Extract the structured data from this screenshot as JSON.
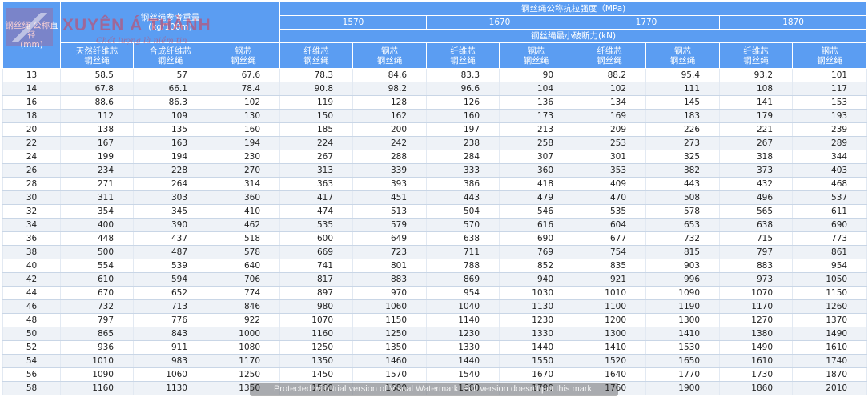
{
  "header": {
    "diameter": "钢丝绳 公称直径",
    "diameter_unit": "(mm)",
    "weight": "钢丝绳参考重量",
    "weight_unit": "(kg/100m)",
    "strength": "钢丝绳公称抗拉强度（MPa)",
    "grades": [
      "1570",
      "1670",
      "1770",
      "1870"
    ],
    "breaking": "钢丝绳最小破断力(kN)",
    "weight_cols": [
      [
        "天然纤维芯",
        "钢丝绳"
      ],
      [
        "合成纤维芯",
        "钢丝绳"
      ],
      [
        "钢芯",
        "钢丝绳"
      ]
    ],
    "core_cols": [
      [
        "纤维芯",
        "钢丝绳"
      ],
      [
        "钢芯",
        "钢丝绳"
      ]
    ]
  },
  "rows": [
    [
      "13",
      "58.5",
      "57",
      "67.6",
      "78.3",
      "84.6",
      "83.3",
      "90",
      "88.2",
      "95.4",
      "93.2",
      "101"
    ],
    [
      "14",
      "67.8",
      "66.1",
      "78.4",
      "90.8",
      "98.2",
      "96.6",
      "104",
      "102",
      "111",
      "108",
      "117"
    ],
    [
      "16",
      "88.6",
      "86.3",
      "102",
      "119",
      "128",
      "126",
      "136",
      "134",
      "145",
      "141",
      "153"
    ],
    [
      "18",
      "112",
      "109",
      "130",
      "150",
      "162",
      "160",
      "173",
      "169",
      "183",
      "179",
      "193"
    ],
    [
      "20",
      "138",
      "135",
      "160",
      "185",
      "200",
      "197",
      "213",
      "209",
      "226",
      "221",
      "239"
    ],
    [
      "22",
      "167",
      "163",
      "194",
      "224",
      "242",
      "238",
      "258",
      "253",
      "273",
      "267",
      "289"
    ],
    [
      "24",
      "199",
      "194",
      "230",
      "267",
      "288",
      "284",
      "307",
      "301",
      "325",
      "318",
      "344"
    ],
    [
      "26",
      "234",
      "228",
      "270",
      "313",
      "339",
      "333",
      "360",
      "353",
      "382",
      "373",
      "403"
    ],
    [
      "28",
      "271",
      "264",
      "314",
      "363",
      "393",
      "386",
      "418",
      "409",
      "443",
      "432",
      "468"
    ],
    [
      "30",
      "311",
      "303",
      "360",
      "417",
      "451",
      "443",
      "479",
      "470",
      "508",
      "496",
      "537"
    ],
    [
      "32",
      "354",
      "345",
      "410",
      "474",
      "513",
      "504",
      "546",
      "535",
      "578",
      "565",
      "611"
    ],
    [
      "34",
      "400",
      "390",
      "462",
      "535",
      "579",
      "570",
      "616",
      "604",
      "653",
      "638",
      "690"
    ],
    [
      "36",
      "448",
      "437",
      "518",
      "600",
      "649",
      "638",
      "690",
      "677",
      "732",
      "715",
      "773"
    ],
    [
      "38",
      "500",
      "487",
      "578",
      "669",
      "723",
      "711",
      "769",
      "754",
      "815",
      "797",
      "861"
    ],
    [
      "40",
      "554",
      "539",
      "640",
      "741",
      "801",
      "788",
      "852",
      "835",
      "903",
      "883",
      "954"
    ],
    [
      "42",
      "610",
      "594",
      "706",
      "817",
      "883",
      "869",
      "940",
      "921",
      "996",
      "973",
      "1050"
    ],
    [
      "44",
      "670",
      "652",
      "774",
      "897",
      "970",
      "954",
      "1030",
      "1010",
      "1090",
      "1070",
      "1150"
    ],
    [
      "46",
      "732",
      "713",
      "846",
      "980",
      "1060",
      "1040",
      "1130",
      "1100",
      "1190",
      "1170",
      "1260"
    ],
    [
      "48",
      "797",
      "776",
      "922",
      "1070",
      "1150",
      "1140",
      "1230",
      "1200",
      "1300",
      "1270",
      "1370"
    ],
    [
      "50",
      "865",
      "843",
      "1000",
      "1160",
      "1250",
      "1230",
      "1330",
      "1300",
      "1410",
      "1380",
      "1490"
    ],
    [
      "52",
      "936",
      "911",
      "1080",
      "1250",
      "1350",
      "1330",
      "1440",
      "1410",
      "1530",
      "1490",
      "1610"
    ],
    [
      "54",
      "1010",
      "983",
      "1170",
      "1350",
      "1460",
      "1440",
      "1550",
      "1520",
      "1650",
      "1610",
      "1740"
    ],
    [
      "56",
      "1090",
      "1060",
      "1250",
      "1450",
      "1570",
      "1540",
      "1670",
      "1640",
      "1770",
      "1730",
      "1870"
    ],
    [
      "58",
      "1160",
      "1130",
      "1350",
      "1560",
      "1680",
      "1660",
      "1790",
      "1760",
      "1900",
      "1860",
      "2010"
    ]
  ],
  "watermarks": {
    "logo": "XUYÊN Á THÀNH",
    "tagline": "Chất lượng là niềm tin",
    "banner": "Protected with trial version of Visual Watermark. Full version doesn't put this mark."
  }
}
